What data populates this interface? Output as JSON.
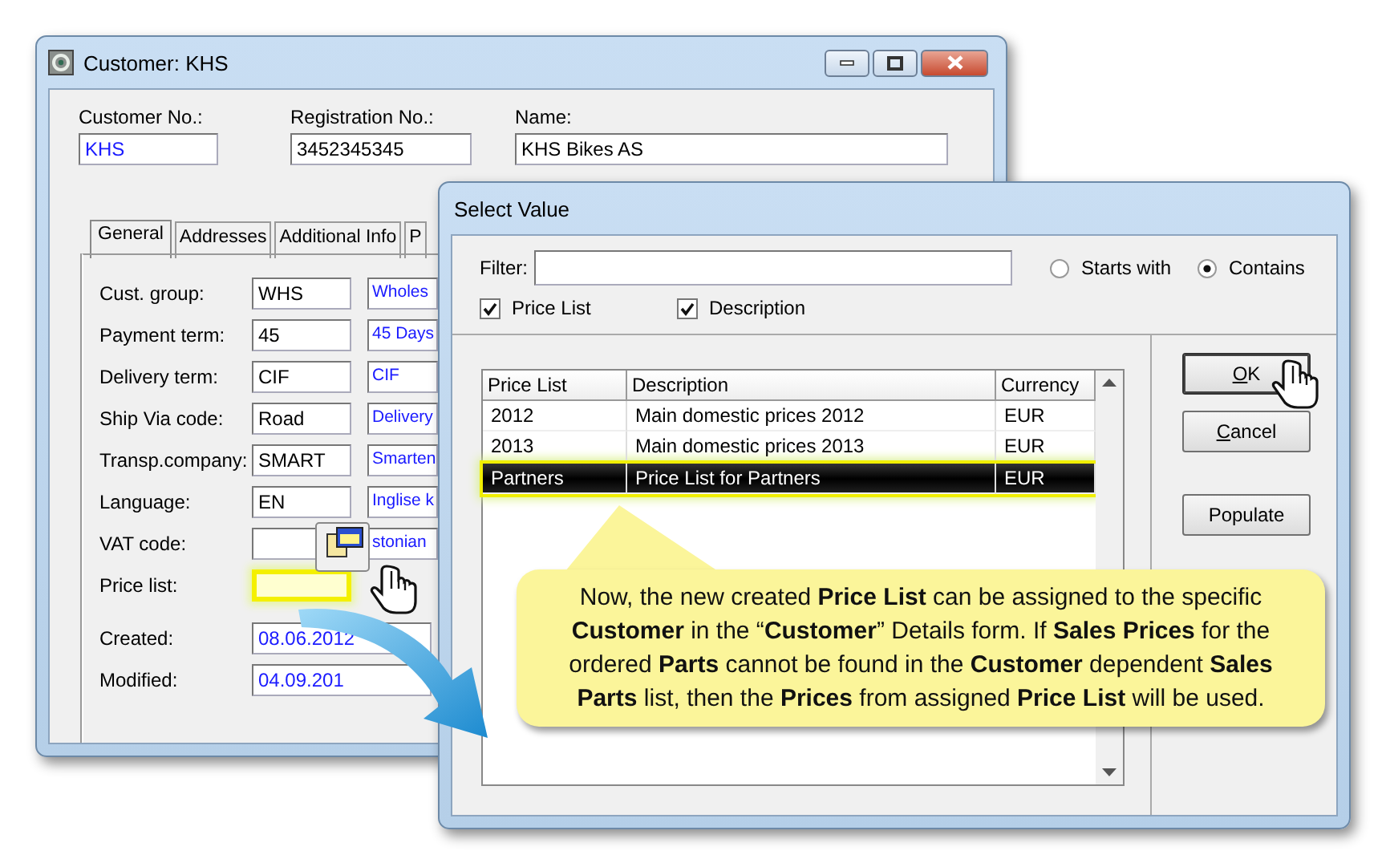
{
  "customer_window": {
    "title": "Customer: KHS",
    "header_fields": [
      {
        "label": "Customer No.:",
        "value": "KHS",
        "link": true
      },
      {
        "label": "Registration No.:",
        "value": "3452345345",
        "link": false
      },
      {
        "label": "Name:",
        "value": "KHS Bikes AS",
        "link": false
      }
    ],
    "tabs": [
      {
        "label": "General",
        "selected": true
      },
      {
        "label": "Addresses",
        "selected": false
      },
      {
        "label": "Additional Info",
        "selected": false
      },
      {
        "label": "P",
        "selected": false
      }
    ],
    "fields": [
      {
        "label": "Cust. group:",
        "code": "WHS",
        "description": "Wholes",
        "highlighted": false
      },
      {
        "label": "Payment term:",
        "code": "45",
        "description": "45 Days",
        "highlighted": false
      },
      {
        "label": "Delivery term:",
        "code": "CIF",
        "description": "CIF",
        "highlighted": false
      },
      {
        "label": "Ship Via code:",
        "code": "Road",
        "description": "Delivery",
        "highlighted": false
      },
      {
        "label": "Transp.company:",
        "code": "SMART",
        "description": "Smarten",
        "highlighted": false
      },
      {
        "label": "Language:",
        "code": "EN",
        "description": "Inglise k",
        "highlighted": false
      },
      {
        "label": "VAT code:",
        "description": "stonian",
        "highlighted": false
      },
      {
        "label": "Price list:",
        "highlighted": true
      }
    ],
    "dates": [
      {
        "label": "Created:",
        "value": "08.06.2012"
      },
      {
        "label": "Modified:",
        "value": "04.09.201"
      }
    ]
  },
  "select_dialog": {
    "title": "Select Value",
    "filter": {
      "label": "Filter:"
    },
    "match_options": [
      {
        "label": "Starts with",
        "selected": false
      },
      {
        "label": "Contains",
        "selected": true
      }
    ],
    "search_in": [
      {
        "label": "Price List",
        "checked": true
      },
      {
        "label": "Description",
        "checked": true
      }
    ],
    "columns": [
      "Price List",
      "Description",
      "Currency"
    ],
    "rows": [
      {
        "cells": [
          "2012",
          "Main domestic prices 2012",
          "EUR"
        ],
        "selected": false
      },
      {
        "cells": [
          "2013",
          "Main domestic prices 2013",
          "EUR"
        ],
        "selected": false
      },
      {
        "cells": [
          "Partners",
          "Price List for Partners",
          "EUR"
        ],
        "selected": true
      }
    ],
    "buttons": [
      {
        "label": "OK",
        "mnemonic": true,
        "default": true
      },
      {
        "label": "Cancel",
        "mnemonic": true,
        "default": false
      },
      {
        "label": "Populate",
        "mnemonic": false,
        "default": false
      }
    ]
  },
  "callout": {
    "text": "Now, the new created **Price List** can be assigned to the specific **Customer** in the “**Customer**” Details form.  If **Sales Prices** for the ordered **Parts** cannot be found in the **Customer** dependent **Sales Parts** list, then the **Prices** from assigned **Price List** will be used."
  }
}
